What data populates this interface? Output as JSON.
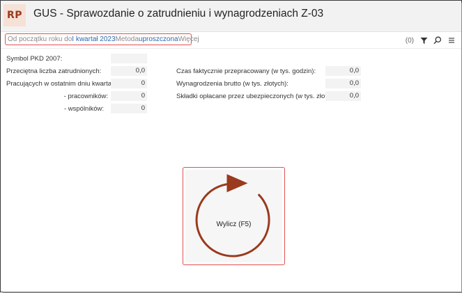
{
  "header": {
    "logo": "RP",
    "title": "GUS - Sprawozdanie o zatrudnieniu i wynagrodzeniach Z-03"
  },
  "filter": {
    "prefix": "Od początku roku do",
    "period": "I kwartał 2023",
    "method_label": "Metoda",
    "method": "uproszczona",
    "more": "Więcej"
  },
  "toolbar": {
    "count": "(0)",
    "icons": [
      "filter-icon",
      "search-icon",
      "menu-icon"
    ]
  },
  "form": {
    "pkd_label": "Symbol PKD 2007:",
    "pkd_value": "",
    "avg_employed_label": "Przeciętna liczba zatrudnionych:",
    "avg_employed_value": "0,0",
    "last_day_label": "Pracujących w ostatnim dniu kwartału:",
    "last_day_value": "0",
    "employees_label": "- pracowników:",
    "employees_value": "0",
    "partners_label": "- wspólników:",
    "partners_value": "0",
    "hours_label": "Czas faktycznie przepracowany (w tys. godzin):",
    "hours_value": "0,0",
    "gross_label": "Wynagrodzenia brutto (w tys. złotych):",
    "gross_value": "0,0",
    "contrib_label": "Składki opłacane przez ubezpieczonych (w tys. złotych):",
    "contrib_value": "0,0"
  },
  "calculate": {
    "label": "Wylicz (F5)",
    "color": "#9a3a1e"
  }
}
